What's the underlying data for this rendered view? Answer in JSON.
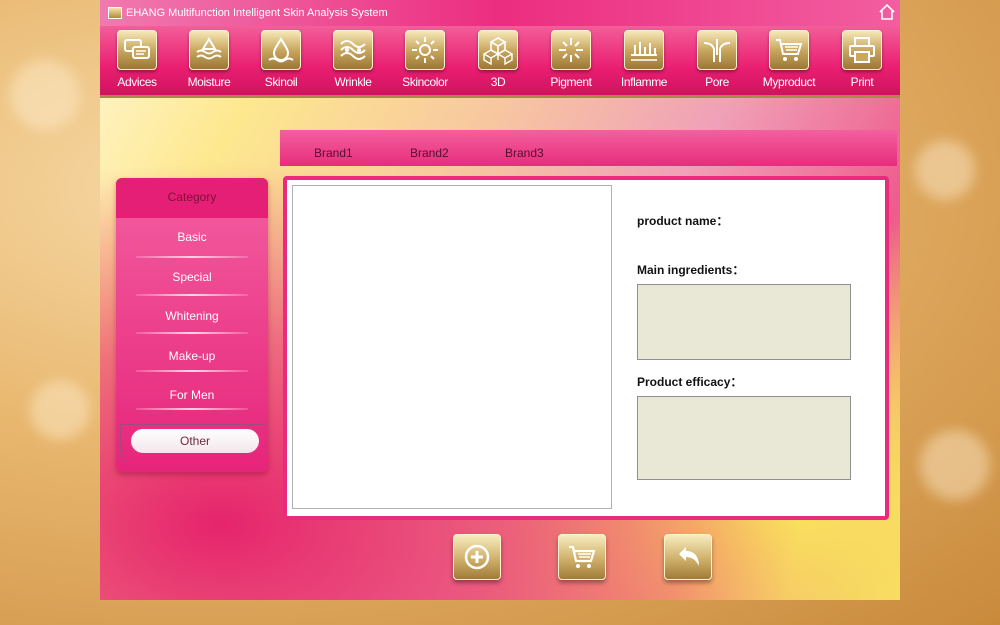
{
  "window": {
    "title": "EHANG Multifunction Intelligent Skin Analysis System"
  },
  "toolbar": [
    {
      "label": "Advices",
      "icon": "chat-bubbles-icon"
    },
    {
      "label": "Moisture",
      "icon": "water-level-icon"
    },
    {
      "label": "Skinoil",
      "icon": "oil-drop-icon"
    },
    {
      "label": "Wrinkle",
      "icon": "wrinkle-icon"
    },
    {
      "label": "Skincolor",
      "icon": "sun-icon"
    },
    {
      "label": "3D",
      "icon": "cubes-icon"
    },
    {
      "label": "Pigment",
      "icon": "sparkle-icon"
    },
    {
      "label": "Inflamme",
      "icon": "inflammation-icon"
    },
    {
      "label": "Pore",
      "icon": "pore-icon"
    },
    {
      "label": "Myproduct",
      "icon": "cart-icon"
    },
    {
      "label": "Print",
      "icon": "printer-icon"
    }
  ],
  "brand_tabs": [
    "Brand1",
    "Brand2",
    "Brand3"
  ],
  "sidebar": {
    "header": "Category",
    "items": [
      "Basic",
      "Special",
      "Whitening",
      "Make-up",
      "For Men",
      "Other"
    ],
    "selected": "Other"
  },
  "product": {
    "name_label": "product name：",
    "ingredients_label": "Main ingredients：",
    "efficacy_label": "Product efficacy："
  },
  "bottom_buttons": [
    {
      "icon": "add-icon"
    },
    {
      "icon": "cart-icon"
    },
    {
      "icon": "back-arrow-icon"
    }
  ],
  "colors": {
    "accent_pink": "#e6257a",
    "gold": "#c9a760"
  }
}
